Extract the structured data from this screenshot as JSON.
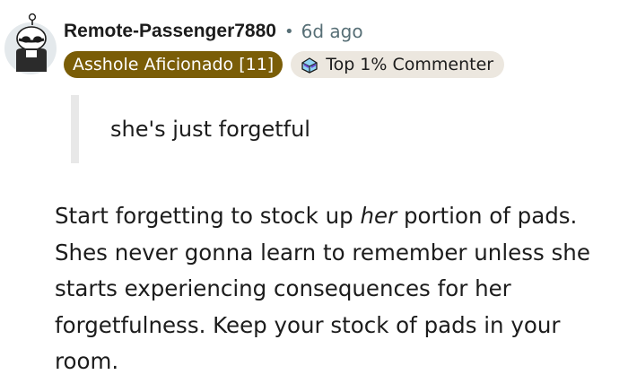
{
  "comment": {
    "author": "Remote-Passenger7880",
    "separator": "•",
    "age": "6d ago",
    "flair": "Asshole Aficionado [11]",
    "badge": {
      "label": "Top 1% Commenter",
      "icon": "top-commenter-icon"
    },
    "quote": "she's just forgetful",
    "body": {
      "line1_before": "Start forgetting to stock up ",
      "line1_emphasis": "her",
      "line1_after": " portion of pads.",
      "line2": "Shes never gonna learn to remember unless she",
      "line3": "starts experiencing consequences for her",
      "line4": "forgetfulness. Keep your stock of pads in your",
      "line5": "room."
    }
  },
  "colors": {
    "flair_bg": "#7a5d07",
    "badge_bg": "#ece7df",
    "quote_bar": "#e8e8e8",
    "meta_text": "#576f76"
  }
}
